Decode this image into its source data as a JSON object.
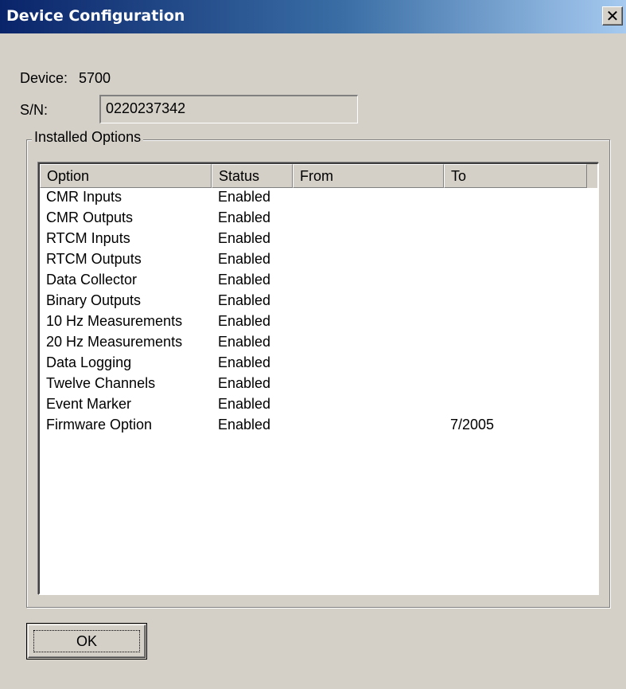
{
  "window": {
    "title": "Device Configuration"
  },
  "device": {
    "device_label": "Device:",
    "device_value": "5700",
    "sn_label": "S/N:",
    "sn_value": "0220237342"
  },
  "options_group": {
    "label": "Installed Options",
    "columns": [
      "Option",
      "Status",
      "From",
      "To"
    ],
    "rows": [
      {
        "option": "CMR Inputs",
        "status": "Enabled",
        "from": "",
        "to": ""
      },
      {
        "option": "CMR Outputs",
        "status": "Enabled",
        "from": "",
        "to": ""
      },
      {
        "option": "RTCM Inputs",
        "status": "Enabled",
        "from": "",
        "to": ""
      },
      {
        "option": "RTCM Outputs",
        "status": "Enabled",
        "from": "",
        "to": ""
      },
      {
        "option": "Data Collector",
        "status": "Enabled",
        "from": "",
        "to": ""
      },
      {
        "option": "Binary Outputs",
        "status": "Enabled",
        "from": "",
        "to": ""
      },
      {
        "option": "10 Hz Measurements",
        "status": "Enabled",
        "from": "",
        "to": ""
      },
      {
        "option": "20 Hz Measurements",
        "status": "Enabled",
        "from": "",
        "to": ""
      },
      {
        "option": "Data Logging",
        "status": "Enabled",
        "from": "",
        "to": ""
      },
      {
        "option": "Twelve Channels",
        "status": "Enabled",
        "from": "",
        "to": ""
      },
      {
        "option": "Event Marker",
        "status": "Enabled",
        "from": "",
        "to": ""
      },
      {
        "option": "Firmware Option",
        "status": "Enabled",
        "from": "",
        "to": "7/2005"
      }
    ]
  },
  "buttons": {
    "ok_label": "OK",
    "close_glyph": "✕"
  },
  "icons": {
    "close": "close-icon"
  },
  "colors": {
    "titlebar_start": "#0a246a",
    "titlebar_end": "#a6caf0",
    "dialog_bg": "#d4d0c8"
  }
}
